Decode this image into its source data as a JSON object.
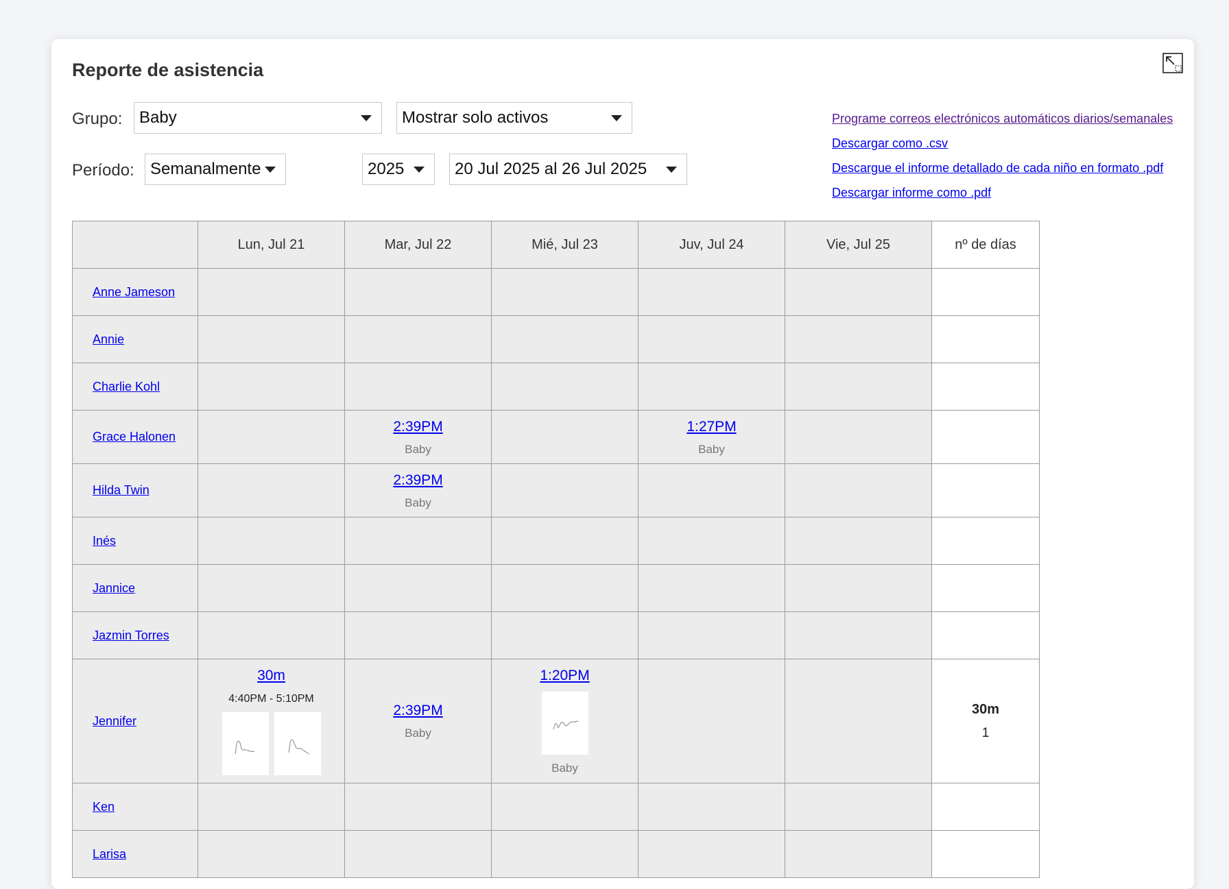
{
  "title": "Reporte de asistencia",
  "filters": {
    "group_label": "Grupo:",
    "group_value": "Baby",
    "status_value": "Mostrar solo activos",
    "period_label": "Período:",
    "period_value": "Semanalmente",
    "year_value": "2025",
    "range_value": "20 Jul 2025 al 26 Jul 2025"
  },
  "links": [
    "Programe correos electrónicos automáticos diarios/semanales",
    "Descargar como .csv",
    "Descargue el informe detallado de cada niño en formato .pdf",
    "Descargar informe como .pdf"
  ],
  "table": {
    "days": [
      "Lun, Jul 21",
      "Mar, Jul 22",
      "Mié, Jul 23",
      "Juv, Jul 24",
      "Vie, Jul 25"
    ],
    "total_header": "nº de días",
    "rows": [
      {
        "name": "Anne Jameson"
      },
      {
        "name": "Annie"
      },
      {
        "name": "Charlie Kohl"
      },
      {
        "name": "Grace Halonen",
        "tue_time": "2:39PM",
        "tue_group": "Baby",
        "thu_time": "1:27PM",
        "thu_group": "Baby"
      },
      {
        "name": "Hilda Twin",
        "tue_time": "2:39PM",
        "tue_group": "Baby"
      },
      {
        "name": "Inés"
      },
      {
        "name": "Jannice"
      },
      {
        "name": "Jazmin Torres"
      },
      {
        "name": "Jennifer",
        "mon_duration": "30m",
        "mon_range": "4:40PM - 5:10PM",
        "tue_time": "2:39PM",
        "tue_group": "Baby",
        "wed_time": "1:20PM",
        "wed_group": "Baby",
        "total_duration": "30m",
        "total_days": "1"
      },
      {
        "name": "Ken"
      },
      {
        "name": "Larisa"
      }
    ]
  },
  "icons": {
    "expand": "expand-icon",
    "dropdown": "caret-down-icon",
    "signature": "signature-icon"
  },
  "colors": {
    "link": "#0000ee",
    "visited_link": "#551a8b",
    "cell_background": "#ececec",
    "page_background": "#f4f5f9"
  }
}
